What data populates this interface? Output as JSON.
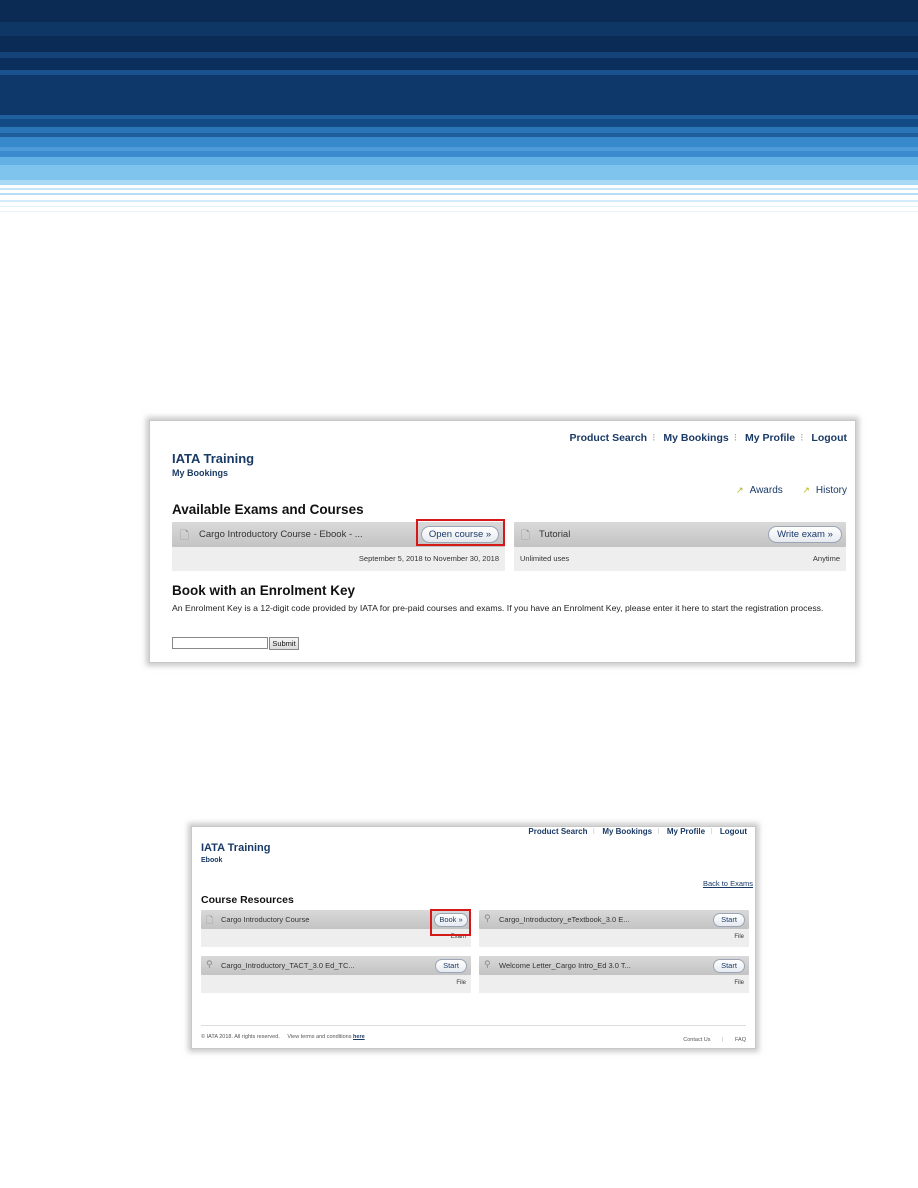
{
  "colors": {
    "navy": "#1a3a66",
    "highlight": "#d51818",
    "banner_dark": "#0b2c57",
    "banner_light": "#7fc4ec"
  },
  "screen1": {
    "nav": {
      "product_search": "Product Search",
      "my_bookings": "My Bookings",
      "my_profile": "My Profile",
      "logout": "Logout"
    },
    "brand": "IATA Training",
    "subtitle": "My Bookings",
    "awards": "Awards",
    "history": "History",
    "section_title": "Available Exams and Courses",
    "cards": [
      {
        "title": "Cargo Introductory Course - Ebook - ...",
        "button": "Open course »",
        "left_info": "",
        "right_info": "September 5, 2018 to November 30, 2018"
      },
      {
        "title": "Tutorial",
        "button": "Write exam »",
        "left_info": "Unlimited uses",
        "right_info": "Anytime"
      }
    ],
    "enrol_title": "Book with an Enrolment Key",
    "enrol_desc": "An Enrolment Key is a 12-digit code provided by IATA for pre-paid courses and exams. If you have an Enrolment Key, please enter it here to start the registration process.",
    "input_value": "",
    "submit": "Submit"
  },
  "screen2": {
    "nav": {
      "product_search": "Product Search",
      "my_bookings": "My Bookings",
      "my_profile": "My Profile",
      "logout": "Logout"
    },
    "brand": "IATA Training",
    "subtitle": "Ebook",
    "back": "Back to Exams",
    "section_title": "Course Resources",
    "resources": [
      {
        "title": "Cargo Introductory Course",
        "button": "Book »",
        "type": "Exam",
        "icon": "document-icon"
      },
      {
        "title": "Cargo_Introductory_eTextbook_3.0 E...",
        "button": "Start",
        "type": "File",
        "icon": "paperclip-icon"
      },
      {
        "title": "Cargo_Introductory_TACT_3.0 Ed_TC...",
        "button": "Start",
        "type": "File",
        "icon": "paperclip-icon"
      },
      {
        "title": "Welcome Letter_Cargo Intro_Ed 3.0 T...",
        "button": "Start",
        "type": "File",
        "icon": "paperclip-icon"
      }
    ],
    "footer": {
      "copyright": "© IATA 2018. All rights reserved.",
      "terms": "View terms and conditions",
      "here": "here",
      "contact": "Contact Us",
      "faq": "FAQ"
    }
  }
}
